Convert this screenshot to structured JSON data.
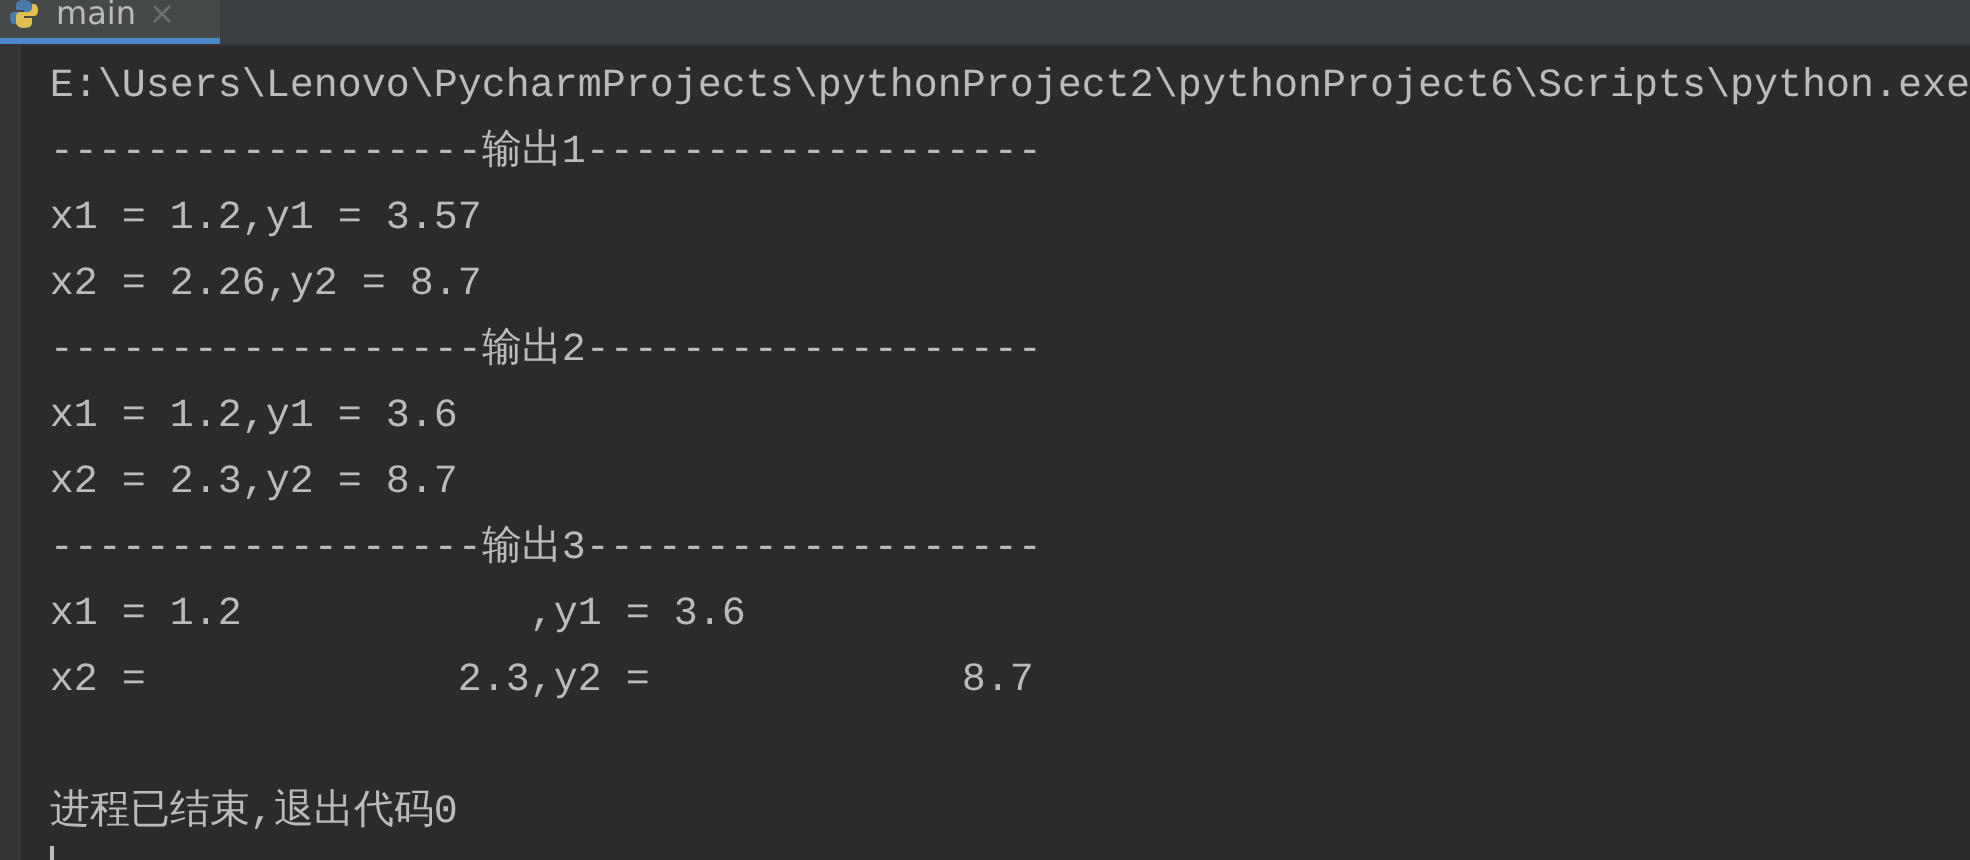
{
  "tabs": [
    {
      "label": "main",
      "selected": true
    }
  ],
  "console": {
    "lines": [
      "E:\\Users\\Lenovo\\PycharmProjects\\pythonProject2\\pythonProject6\\Scripts\\python.exe",
      "------------------输出1-------------------",
      "x1 = 1.2,y1 = 3.57",
      "x2 = 2.26,y2 = 8.7",
      "------------------输出2-------------------",
      "x1 = 1.2,y1 = 3.6",
      "x2 = 2.3,y2 = 8.7",
      "------------------输出3-------------------",
      "x1 = 1.2            ,y1 = 3.6",
      "x2 =             2.3,y2 =             8.7"
    ],
    "exit_message": "进程已结束,退出代码0"
  }
}
